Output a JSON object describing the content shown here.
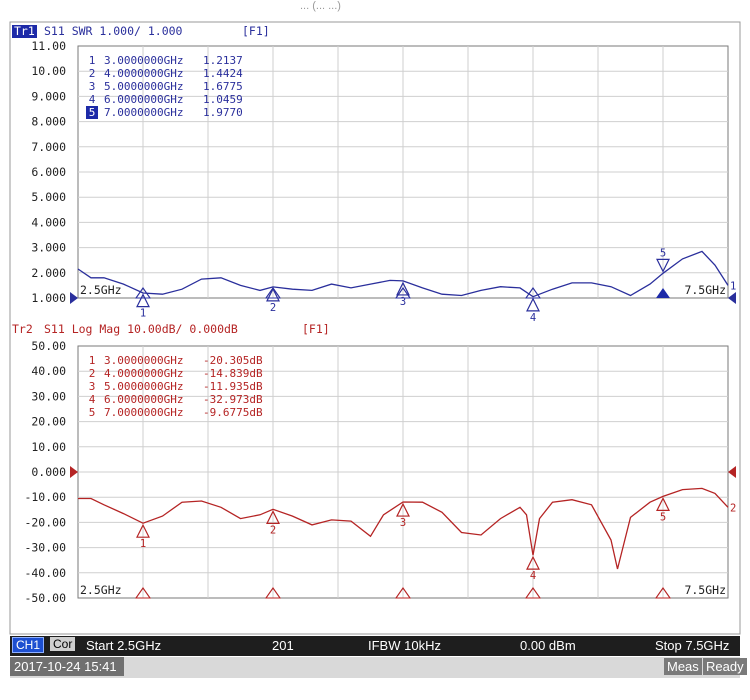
{
  "caption": "... (... ...)",
  "chart_data": [
    {
      "type": "line",
      "trace_label": "Tr1",
      "header": "S11  SWR 1.000/ 1.000",
      "function_key": "[F1]",
      "x_unit": "GHz",
      "xlim": [
        2.5,
        7.5
      ],
      "x_start_label": "2.5GHz",
      "x_stop_label": "7.5GHz",
      "ylim": [
        1.0,
        11.0
      ],
      "y_ticks": [
        "11.00",
        "10.00",
        "9.000",
        "8.000",
        "7.000",
        "6.000",
        "5.000",
        "4.000",
        "3.000",
        "2.000",
        "1.000"
      ],
      "reference_value": 1.0,
      "color": "#2a2f9c",
      "series": [
        {
          "x": [
            2.5,
            2.6,
            2.7,
            2.85,
            3.0,
            3.15,
            3.3,
            3.45,
            3.6,
            3.75,
            3.9,
            4.0,
            4.15,
            4.3,
            4.45,
            4.6,
            4.75,
            4.9,
            5.0,
            5.15,
            5.3,
            5.45,
            5.6,
            5.75,
            5.9,
            6.0,
            6.15,
            6.3,
            6.45,
            6.6,
            6.75,
            6.9,
            7.0,
            7.15,
            7.3,
            7.4,
            7.5
          ],
          "y": [
            2.15,
            1.8,
            1.8,
            1.55,
            1.2,
            1.15,
            1.35,
            1.75,
            1.8,
            1.5,
            1.3,
            1.44,
            1.35,
            1.3,
            1.55,
            1.4,
            1.55,
            1.7,
            1.68,
            1.4,
            1.15,
            1.1,
            1.3,
            1.45,
            1.4,
            1.05,
            1.35,
            1.6,
            1.6,
            1.45,
            1.1,
            1.55,
            1.98,
            2.55,
            2.85,
            2.3,
            1.5
          ]
        }
      ],
      "markers": [
        {
          "id": "1",
          "x": 3.0,
          "y": 1.2137,
          "freq": "3.0000000GHz",
          "value": "1.2137"
        },
        {
          "id": "2",
          "x": 4.0,
          "y": 1.4424,
          "freq": "4.0000000GHz",
          "value": "1.4424"
        },
        {
          "id": "3",
          "x": 5.0,
          "y": 1.6775,
          "freq": "5.0000000GHz",
          "value": "1.6775"
        },
        {
          "id": "4",
          "x": 6.0,
          "y": 1.0459,
          "freq": "6.0000000GHz",
          "value": "1.0459"
        },
        {
          "id": "5",
          "x": 7.0,
          "y": 1.977,
          "freq": "7.0000000GHz",
          "value": "1.9770",
          "active": true
        }
      ],
      "end_label": "1"
    },
    {
      "type": "line",
      "trace_label": "Tr2",
      "header": "S11  Log Mag 10.00dB/ 0.000dB",
      "function_key": "[F1]",
      "x_unit": "GHz",
      "xlim": [
        2.5,
        7.5
      ],
      "x_start_label": "2.5GHz",
      "x_stop_label": "7.5GHz",
      "ylim": [
        -50.0,
        50.0
      ],
      "y_ticks": [
        "50.00",
        "40.00",
        "30.00",
        "20.00",
        "10.00",
        "0.000",
        "-10.00",
        "-20.00",
        "-30.00",
        "-40.00",
        "-50.00"
      ],
      "reference_value": 0.0,
      "color": "#b52424",
      "series": [
        {
          "x": [
            2.5,
            2.6,
            2.7,
            2.85,
            3.0,
            3.15,
            3.3,
            3.45,
            3.6,
            3.75,
            3.9,
            4.0,
            4.15,
            4.3,
            4.45,
            4.6,
            4.75,
            4.85,
            5.0,
            5.15,
            5.3,
            5.45,
            5.6,
            5.75,
            5.9,
            5.95,
            6.0,
            6.05,
            6.15,
            6.3,
            6.45,
            6.6,
            6.65,
            6.75,
            6.9,
            7.0,
            7.15,
            7.3,
            7.4,
            7.5
          ],
          "y": [
            -10.5,
            -10.5,
            -13,
            -16.5,
            -20.3,
            -17.5,
            -12,
            -11.5,
            -14,
            -18.5,
            -17,
            -14.8,
            -17.5,
            -21,
            -19,
            -19.5,
            -25.5,
            -17,
            -11.9,
            -12,
            -16,
            -24,
            -25,
            -18.5,
            -14,
            -17,
            -33.0,
            -18.5,
            -12,
            -11,
            -13,
            -27,
            -38.5,
            -18,
            -12,
            -9.7,
            -7,
            -6.5,
            -8.5,
            -14
          ]
        }
      ],
      "markers": [
        {
          "id": "1",
          "x": 3.0,
          "y": -20.305,
          "freq": "3.0000000GHz",
          "value": "-20.305dB"
        },
        {
          "id": "2",
          "x": 4.0,
          "y": -14.839,
          "freq": "4.0000000GHz",
          "value": "-14.839dB"
        },
        {
          "id": "3",
          "x": 5.0,
          "y": -11.935,
          "freq": "5.0000000GHz",
          "value": "-11.935dB"
        },
        {
          "id": "4",
          "x": 6.0,
          "y": -32.973,
          "freq": "6.0000000GHz",
          "value": "-32.973dB"
        },
        {
          "id": "5",
          "x": 7.0,
          "y": -9.6775,
          "freq": "7.0000000GHz",
          "value": "-9.6775dB"
        }
      ],
      "end_label": "2"
    }
  ],
  "status": {
    "channel": "CH1",
    "cor": "Cor",
    "start": "Start 2.5GHz",
    "points": "201",
    "ifbw": "IFBW 10kHz",
    "power": "0.00 dBm",
    "stop": "Stop 7.5GHz"
  },
  "footer": {
    "datetime": "2017-10-24 15:41",
    "meas": "Meas",
    "ready": "Ready"
  }
}
